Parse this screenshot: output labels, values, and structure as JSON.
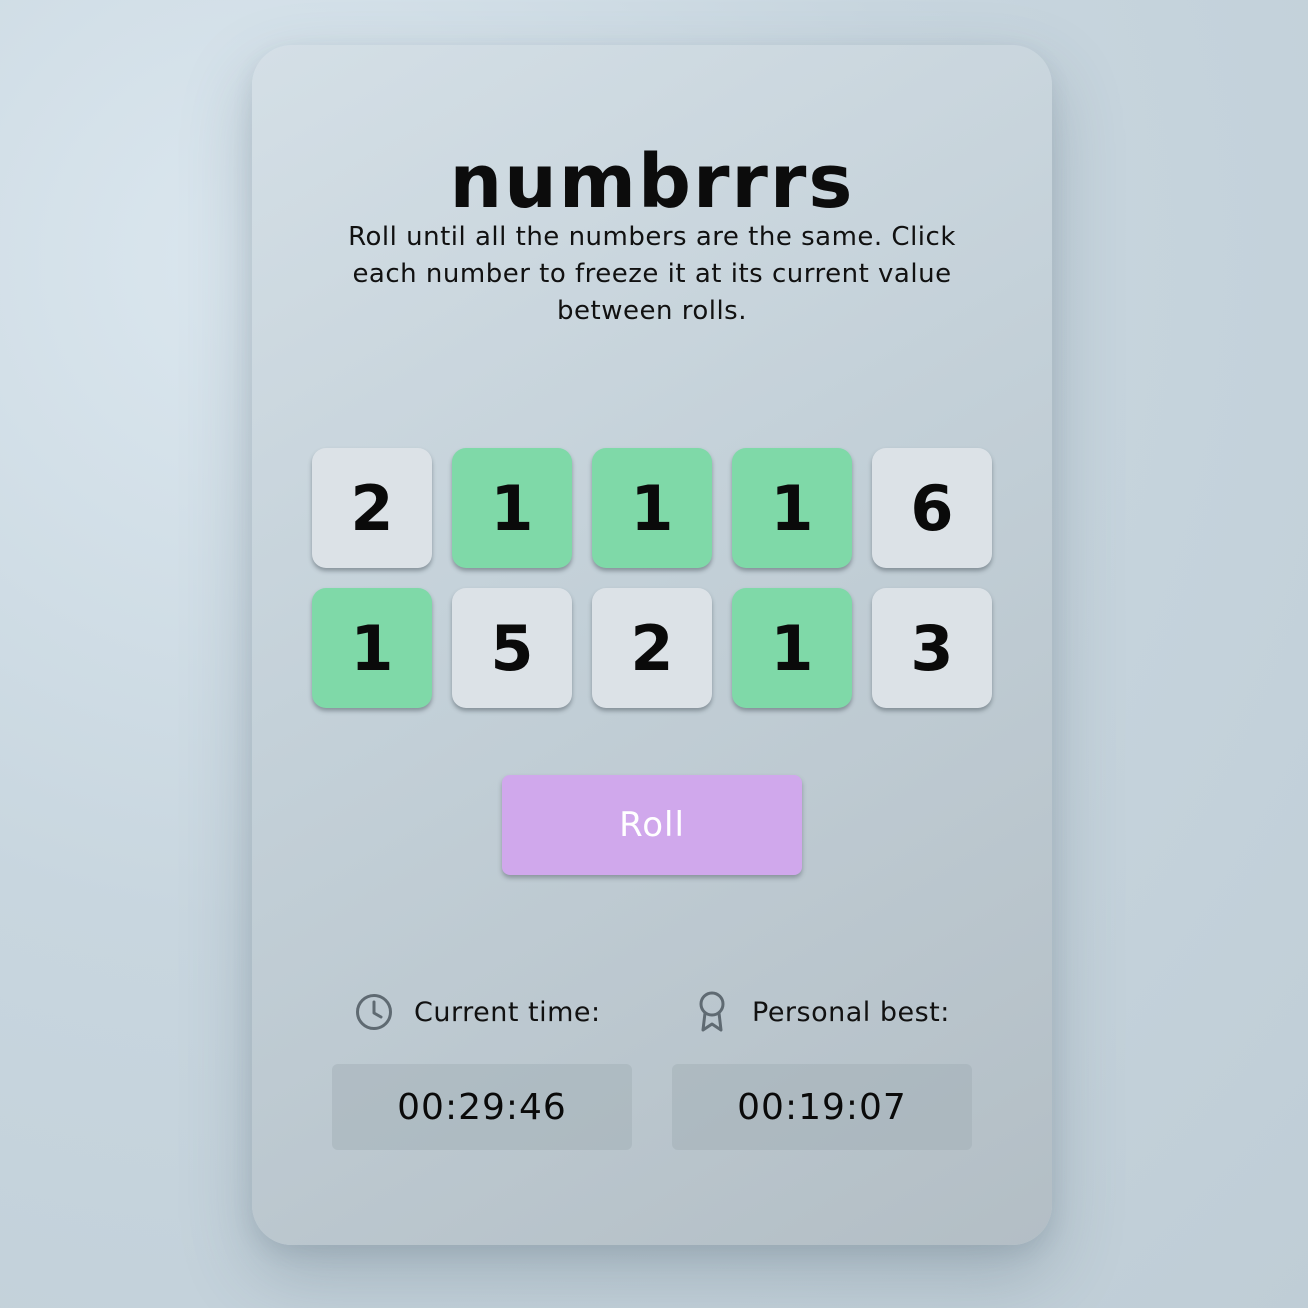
{
  "app": {
    "title": "numbrrrs",
    "description": "Roll until all the numbers are the same. Click each number to freeze it at its current value between rolls."
  },
  "dice": [
    {
      "value": "2",
      "frozen": false
    },
    {
      "value": "1",
      "frozen": true
    },
    {
      "value": "1",
      "frozen": true
    },
    {
      "value": "1",
      "frozen": true
    },
    {
      "value": "6",
      "frozen": false
    },
    {
      "value": "1",
      "frozen": true
    },
    {
      "value": "5",
      "frozen": false
    },
    {
      "value": "2",
      "frozen": false
    },
    {
      "value": "1",
      "frozen": true
    },
    {
      "value": "3",
      "frozen": false
    }
  ],
  "roll_button": {
    "label": "Roll"
  },
  "stats": {
    "current": {
      "label": "Current time:",
      "value": "00:29:46",
      "icon": "clock-icon"
    },
    "best": {
      "label": "Personal best:",
      "value": "00:19:07",
      "icon": "award-icon"
    }
  },
  "colors": {
    "frozen_tile": "#7fd9a8",
    "unfrozen_tile": "#dce2e7",
    "roll_button": "#d0a8ec",
    "card": "#c8d4dc"
  }
}
